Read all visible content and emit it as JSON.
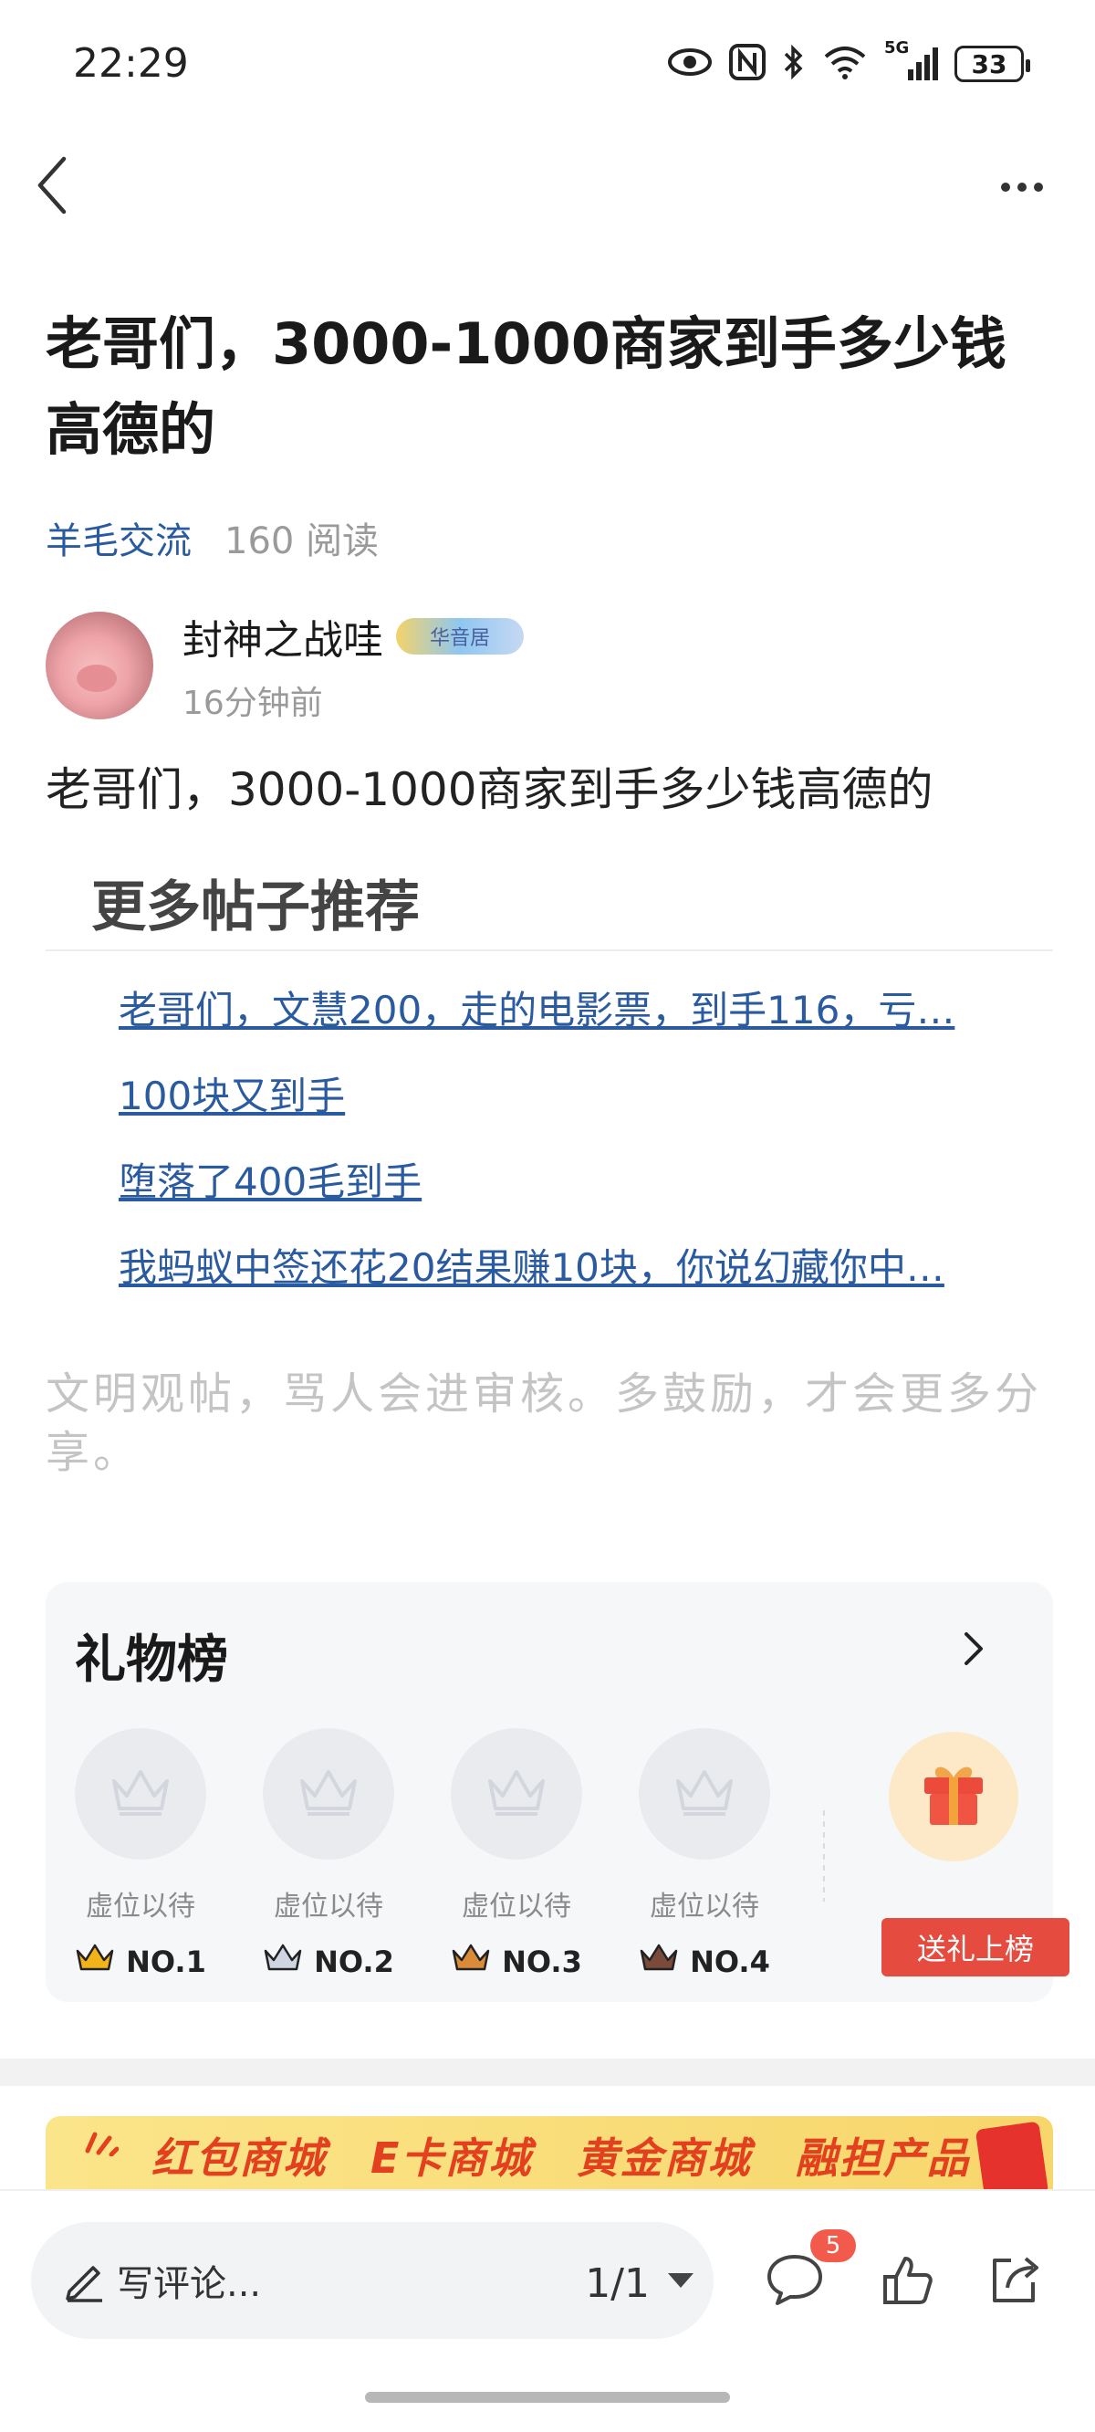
{
  "status_bar": {
    "time": "22:29",
    "network": "5G",
    "battery": "33",
    "icons": [
      "eye-icon",
      "nfc-icon",
      "bluetooth-icon",
      "wifi-icon",
      "signal-icon",
      "battery-icon"
    ]
  },
  "nav": {
    "back_icon": "chevron-left-icon",
    "more_icon": "more-horizontal-icon"
  },
  "post": {
    "title": "老哥们，3000-1000商家到手多少钱高德的",
    "category": "羊毛交流",
    "reads": "160 阅读",
    "author": {
      "name": "封神之战哇",
      "badge": "华音居",
      "time": "16分钟前"
    },
    "body": "老哥们，3000-1000商家到手多少钱高德的"
  },
  "recommendations": {
    "title": "更多帖子推荐",
    "items": [
      "老哥们，文慧200，走的电影票，到手116，亏…",
      "100块又到手",
      "堕落了400毛到手",
      "我蚂蚁中签还花20结果赚10块，你说幻藏你中…"
    ]
  },
  "notice": "文明观帖，骂人会进审核。多鼓励，才会更多分享。",
  "gift_board": {
    "title": "礼物榜",
    "slots": [
      {
        "label": "虚位以待",
        "rank": "NO.1",
        "crown_color": "#f2b21a"
      },
      {
        "label": "虚位以待",
        "rank": "NO.2",
        "crown_color": "#9aa3b5"
      },
      {
        "label": "虚位以待",
        "rank": "NO.3",
        "crown_color": "#d98b3a"
      },
      {
        "label": "虚位以待",
        "rank": "NO.4",
        "crown_color": "#7a4a3a"
      }
    ],
    "send_label": "送礼上榜"
  },
  "banner": {
    "items": [
      "红包商城",
      "E卡商城",
      "黄金商城",
      "融担产品"
    ]
  },
  "bottom_bar": {
    "comment_placeholder": "写评论...",
    "page_indicator": "1/1",
    "comment_count": "5"
  },
  "colors": {
    "link": "#2a5aa0",
    "accent_red": "#e54c3f",
    "banner_text": "#e2401e"
  }
}
